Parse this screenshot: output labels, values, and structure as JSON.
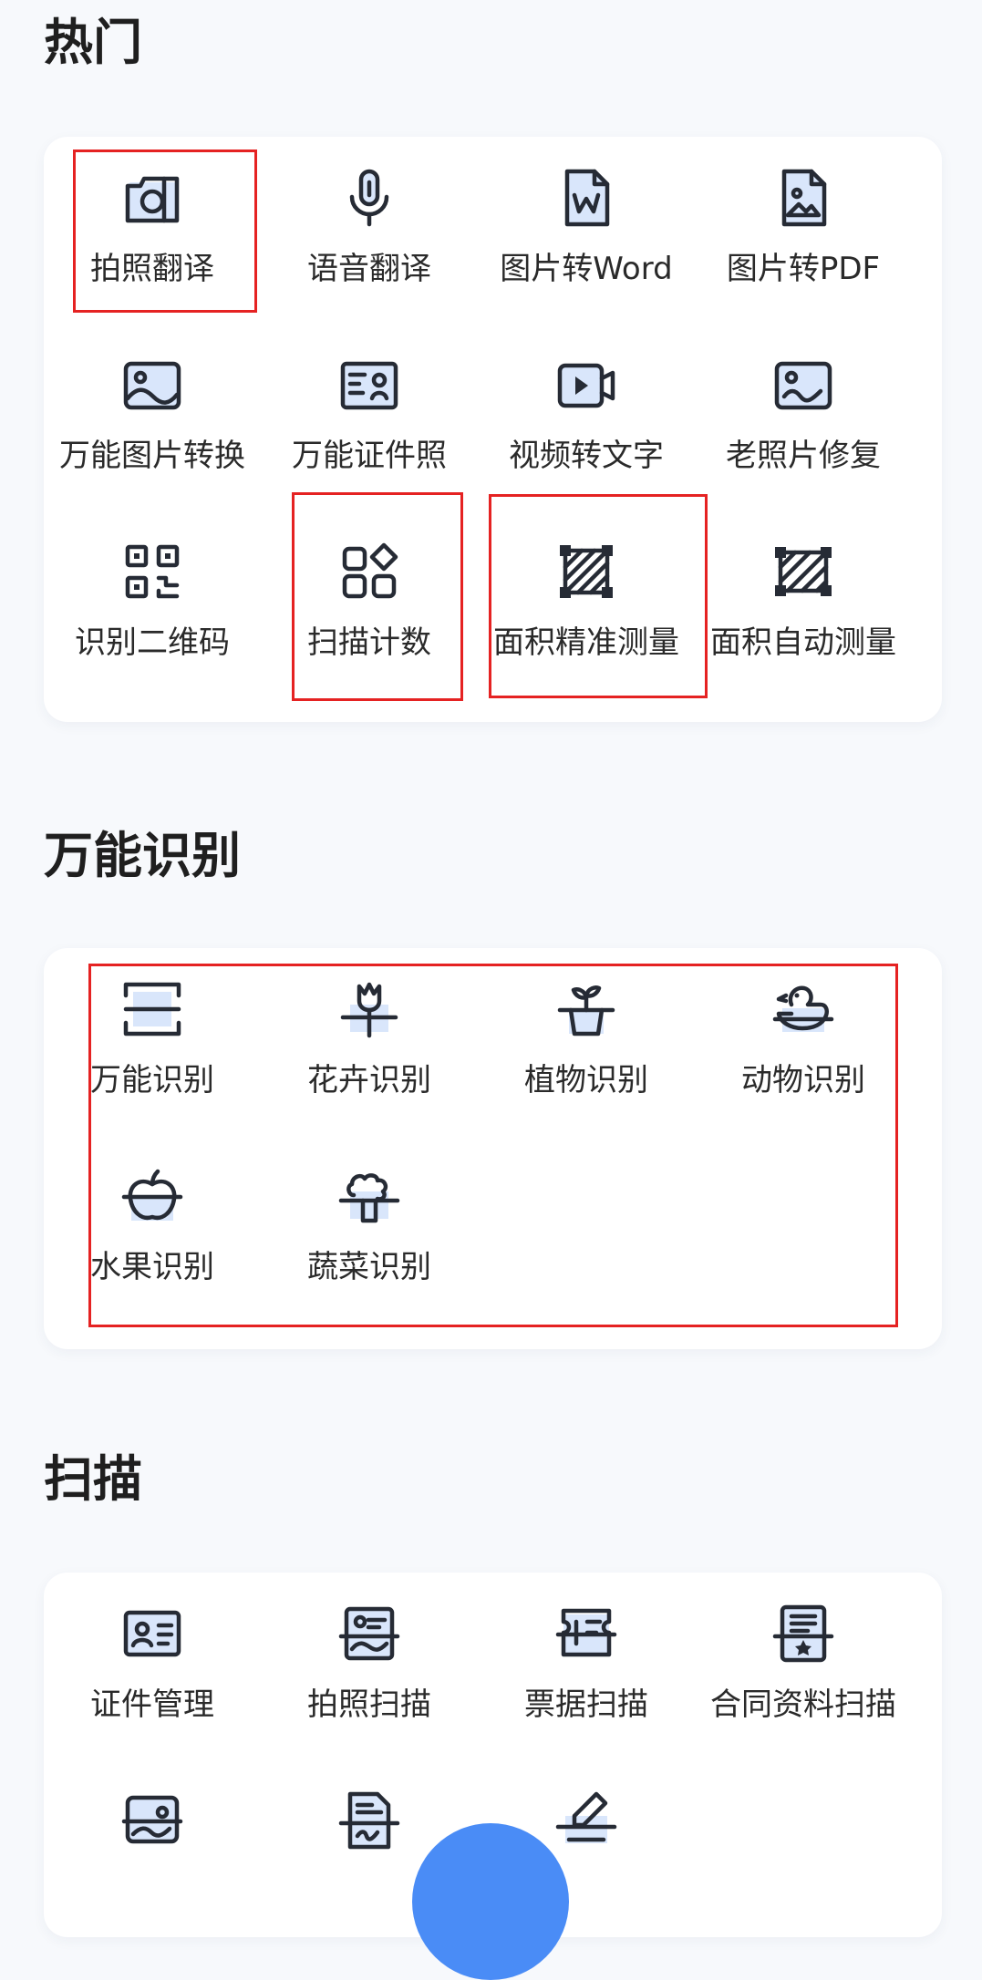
{
  "sections": [
    {
      "title": "热门",
      "items": [
        {
          "label": "拍照翻译",
          "icon": "camera-translate-icon"
        },
        {
          "label": "语音翻译",
          "icon": "microphone-icon"
        },
        {
          "label": "图片转Word",
          "icon": "word-document-icon"
        },
        {
          "label": "图片转PDF",
          "icon": "pdf-image-document-icon"
        },
        {
          "label": "万能图片转换",
          "icon": "image-convert-icon"
        },
        {
          "label": "万能证件照",
          "icon": "id-photo-icon"
        },
        {
          "label": "视频转文字",
          "icon": "video-camera-icon"
        },
        {
          "label": "老照片修复",
          "icon": "old-photo-icon"
        },
        {
          "label": "识别二维码",
          "icon": "qr-code-icon"
        },
        {
          "label": "扫描计数",
          "icon": "scan-count-icon"
        },
        {
          "label": "面积精准测量",
          "icon": "area-measure-icon"
        },
        {
          "label": "面积自动测量",
          "icon": "area-auto-measure-icon"
        }
      ]
    },
    {
      "title": "万能识别",
      "items": [
        {
          "label": "万能识别",
          "icon": "scan-frame-icon"
        },
        {
          "label": "花卉识别",
          "icon": "flower-icon"
        },
        {
          "label": "植物识别",
          "icon": "plant-pot-icon"
        },
        {
          "label": "动物识别",
          "icon": "duck-icon"
        },
        {
          "label": "水果识别",
          "icon": "apple-icon"
        },
        {
          "label": "蔬菜识别",
          "icon": "broccoli-icon"
        }
      ]
    },
    {
      "title": "扫描",
      "items": [
        {
          "label": "证件管理",
          "icon": "id-card-icon"
        },
        {
          "label": "拍照扫描",
          "icon": "photo-scan-icon"
        },
        {
          "label": "票据扫描",
          "icon": "ticket-scan-icon"
        },
        {
          "label": "合同资料扫描",
          "icon": "contract-scan-icon"
        },
        {
          "label": "",
          "icon": "image-scan-icon"
        },
        {
          "label": "",
          "icon": "document-scan-icon"
        },
        {
          "label": "",
          "icon": "signature-scan-icon"
        }
      ]
    }
  ],
  "colors": {
    "background": "#f7f9fc",
    "card": "#ffffff",
    "highlight": "#e52222",
    "fab": "#4a8cf6",
    "icon": "#262b35"
  }
}
